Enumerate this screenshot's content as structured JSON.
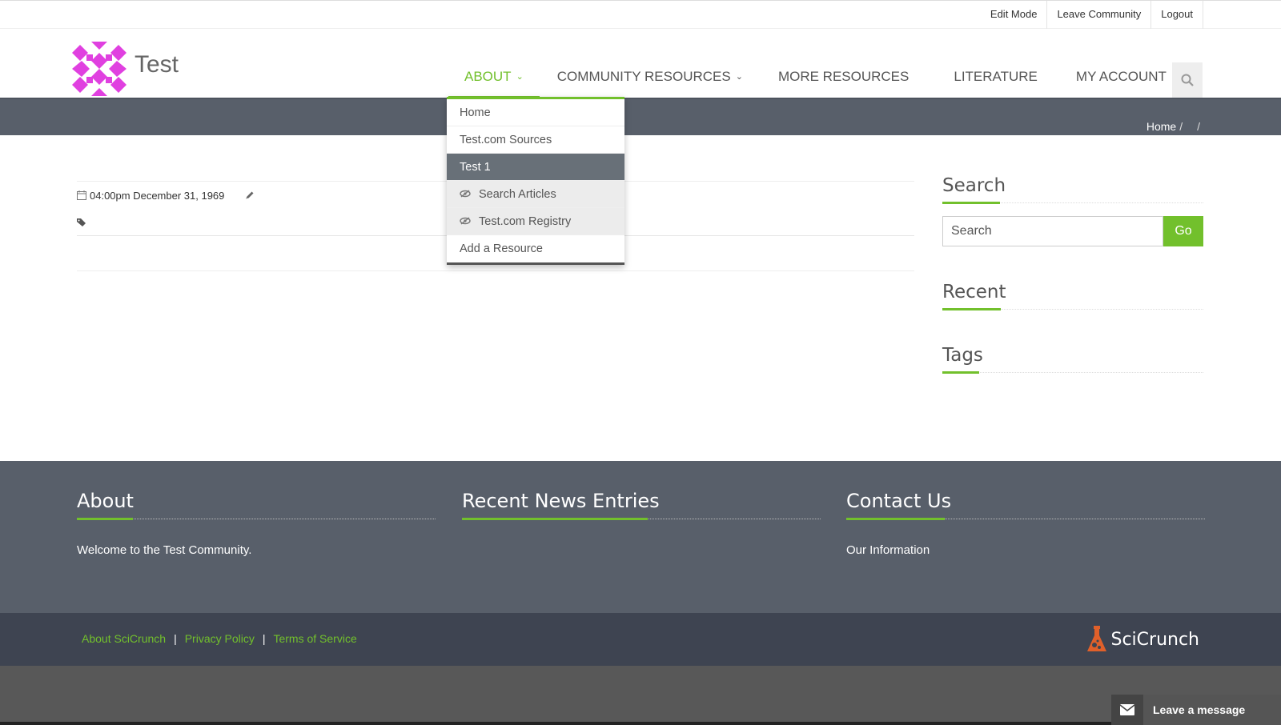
{
  "topbar": {
    "links": [
      "Edit Mode",
      "Leave Community",
      "Logout"
    ]
  },
  "header": {
    "brand": "Test"
  },
  "nav": {
    "items": [
      {
        "label": "ABOUT",
        "has_menu": true
      },
      {
        "label": "COMMUNITY RESOURCES",
        "has_menu": true
      },
      {
        "label": "MORE RESOURCES",
        "has_menu": false
      },
      {
        "label": "LITERATURE",
        "has_menu": false
      },
      {
        "label": "MY ACCOUNT",
        "has_menu": true
      }
    ],
    "chevron": "⌄"
  },
  "dropdown": {
    "items": [
      "Home",
      "Test.com Sources",
      "Test 1",
      "Search Articles",
      "Test.com Registry",
      "Add a Resource"
    ]
  },
  "breadcrumb": {
    "home": "Home",
    "sep": "/"
  },
  "post": {
    "date": "04:00pm December 31, 1969"
  },
  "sidebar": {
    "search_title": "Search",
    "search_placeholder": "Search",
    "go_label": "Go",
    "recent_title": "Recent",
    "tags_title": "Tags"
  },
  "footer": {
    "about_title": "About",
    "about_text": "Welcome to the Test Community.",
    "news_title": "Recent News Entries",
    "contact_title": "Contact Us",
    "contact_text": "Our Information"
  },
  "copyright": {
    "links": [
      "About SciCrunch",
      "Privacy Policy",
      "Terms of Service"
    ],
    "pipe": "|",
    "brand": "SciCrunch"
  },
  "chat": {
    "label": "Leave a message"
  },
  "colors": {
    "accent": "#72c02c",
    "band": "#585f6a",
    "footer_dark": "#3e4451",
    "logo": "#e040e0"
  }
}
